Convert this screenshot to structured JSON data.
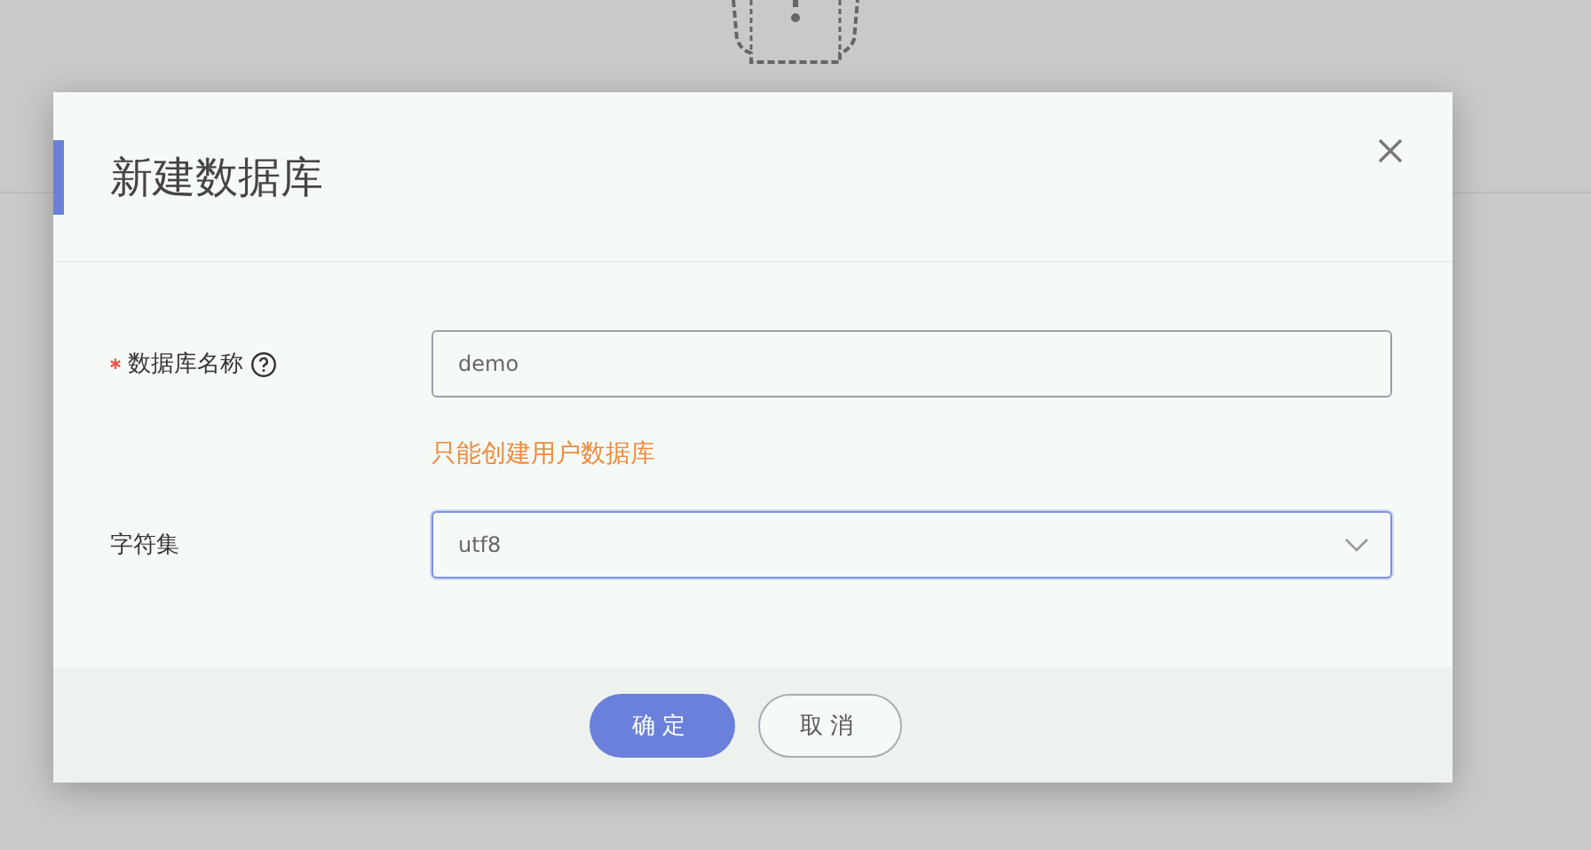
{
  "dialog": {
    "title": "新建数据库",
    "fields": [
      {
        "kind": "text",
        "label": "数据库名称",
        "required": true,
        "help": true,
        "value": "demo",
        "hint": "只能创建用户数据库",
        "focused": false
      },
      {
        "kind": "select",
        "label": "字符集",
        "required": false,
        "help": false,
        "value": "utf8",
        "focused": true
      }
    ],
    "buttons": [
      {
        "label": "确定",
        "primary": true
      },
      {
        "label": "取消",
        "primary": false
      }
    ]
  }
}
